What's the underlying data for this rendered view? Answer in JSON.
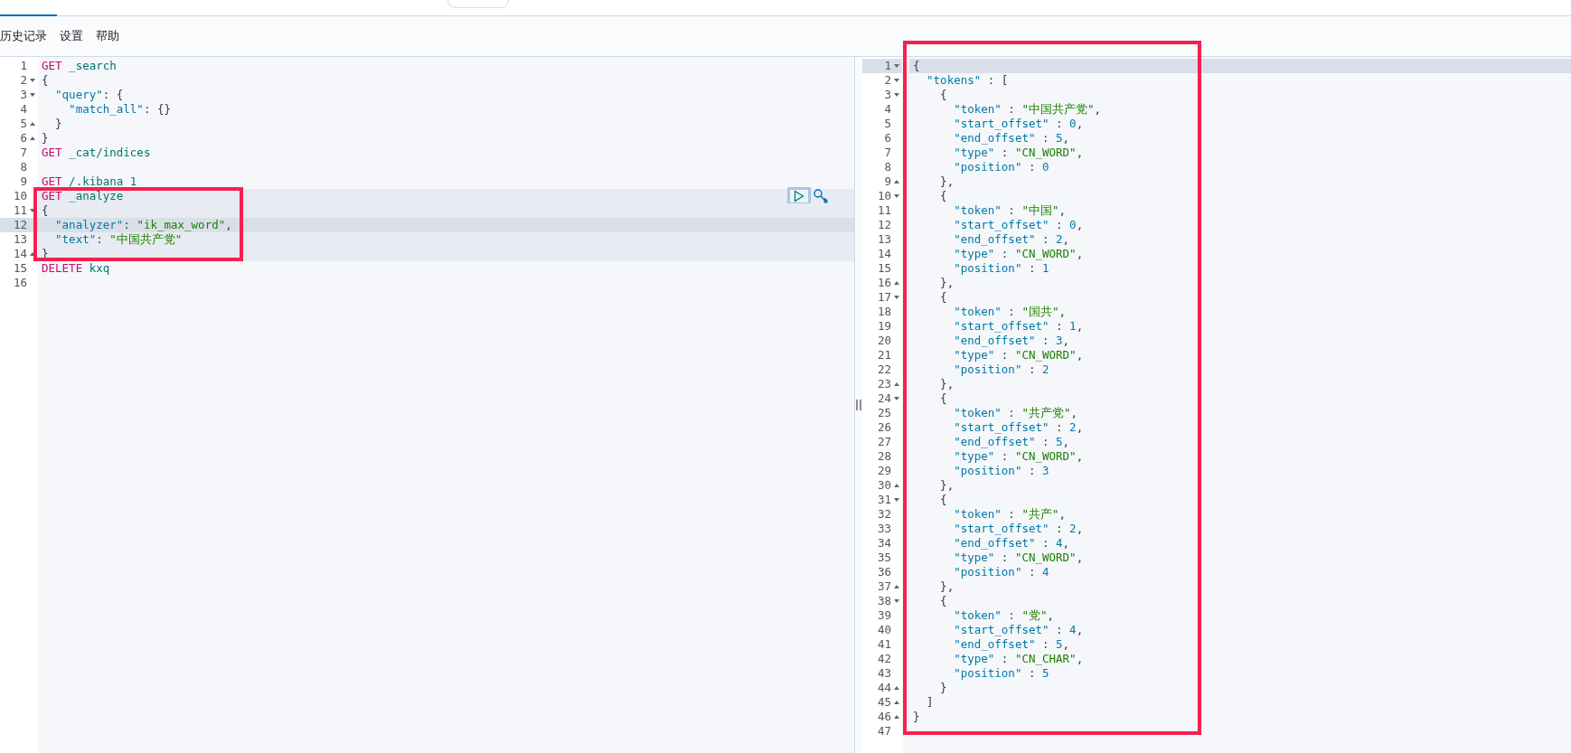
{
  "menu": [
    {
      "label": "历史记录"
    },
    {
      "label": "设置"
    },
    {
      "label": "帮助"
    }
  ],
  "request_editor": {
    "lines": [
      {
        "number": "1",
        "fold_start": false,
        "fold_end": false,
        "highlighted": false,
        "current": false,
        "tokens": [
          {
            "kind": "method",
            "text": "GET"
          },
          {
            "kind": "url",
            "text": " _search"
          }
        ]
      },
      {
        "number": "2",
        "fold_start": true,
        "fold_end": false,
        "highlighted": false,
        "current": false,
        "tokens": [
          {
            "kind": "punct",
            "text": "{"
          }
        ]
      },
      {
        "number": "3",
        "fold_start": true,
        "fold_end": false,
        "highlighted": false,
        "current": false,
        "tokens": [
          {
            "kind": "key",
            "text": "  \"query\""
          },
          {
            "kind": "punct",
            "text": ": {"
          }
        ]
      },
      {
        "number": "4",
        "fold_start": false,
        "fold_end": false,
        "highlighted": false,
        "current": false,
        "tokens": [
          {
            "kind": "key",
            "text": "    \"match_all\""
          },
          {
            "kind": "punct",
            "text": ": {}"
          }
        ]
      },
      {
        "number": "5",
        "fold_start": false,
        "fold_end": true,
        "highlighted": false,
        "current": false,
        "tokens": [
          {
            "kind": "punct",
            "text": "  }"
          }
        ]
      },
      {
        "number": "6",
        "fold_start": false,
        "fold_end": true,
        "highlighted": false,
        "current": false,
        "tokens": [
          {
            "kind": "punct",
            "text": "}"
          }
        ]
      },
      {
        "number": "7",
        "fold_start": false,
        "fold_end": false,
        "highlighted": false,
        "current": false,
        "tokens": [
          {
            "kind": "method",
            "text": "GET"
          },
          {
            "kind": "url",
            "text": " _cat/indices"
          }
        ]
      },
      {
        "number": "8",
        "fold_start": false,
        "fold_end": false,
        "highlighted": false,
        "current": false
      },
      {
        "number": "9",
        "fold_start": false,
        "fold_end": false,
        "highlighted": false,
        "current": false,
        "tokens": [
          {
            "kind": "method",
            "text": "GET"
          },
          {
            "kind": "url",
            "text": " /.kibana_1"
          }
        ]
      },
      {
        "number": "10",
        "fold_start": false,
        "fold_end": false,
        "highlighted": true,
        "current": false,
        "actions": true,
        "tokens": [
          {
            "kind": "method",
            "text": "GET"
          },
          {
            "kind": "url",
            "text": " _analyze"
          }
        ]
      },
      {
        "number": "11",
        "fold_start": true,
        "fold_end": false,
        "highlighted": true,
        "current": false,
        "tokens": [
          {
            "kind": "punct",
            "text": "{"
          }
        ]
      },
      {
        "number": "12",
        "fold_start": false,
        "fold_end": false,
        "highlighted": true,
        "current": true,
        "tokens": [
          {
            "kind": "key",
            "text": "  \"analyzer\""
          },
          {
            "kind": "punct",
            "text": ": "
          },
          {
            "kind": "string",
            "text": "\"ik_max_word\""
          },
          {
            "kind": "punct",
            "text": ","
          }
        ]
      },
      {
        "number": "13",
        "fold_start": false,
        "fold_end": false,
        "highlighted": true,
        "current": false,
        "tokens": [
          {
            "kind": "key",
            "text": "  \"text\""
          },
          {
            "kind": "punct",
            "text": ": "
          },
          {
            "kind": "string",
            "text": "\"中国共产党\""
          }
        ]
      },
      {
        "number": "14",
        "fold_start": false,
        "fold_end": true,
        "highlighted": true,
        "current": false,
        "tokens": [
          {
            "kind": "punct",
            "text": "}"
          }
        ]
      },
      {
        "number": "15",
        "fold_start": false,
        "fold_end": false,
        "highlighted": false,
        "current": false,
        "tokens": [
          {
            "kind": "method",
            "text": "DELETE"
          },
          {
            "kind": "url",
            "text": " kxq"
          }
        ]
      },
      {
        "number": "16",
        "fold_start": false,
        "fold_end": false,
        "highlighted": false,
        "current": false
      }
    ]
  },
  "response_viewer": {
    "lines": [
      {
        "number": "1",
        "fold_start": true,
        "fold_end": false,
        "current": true,
        "tokens": [
          {
            "kind": "punct",
            "text": "{"
          }
        ]
      },
      {
        "number": "2",
        "fold_start": true,
        "fold_end": false,
        "current": false,
        "tokens": [
          {
            "kind": "key",
            "text": "  \"tokens\""
          },
          {
            "kind": "punct",
            "text": " : ["
          }
        ]
      },
      {
        "number": "3",
        "fold_start": true,
        "fold_end": false,
        "current": false,
        "tokens": [
          {
            "kind": "punct",
            "text": "    {"
          }
        ]
      },
      {
        "number": "4",
        "fold_start": false,
        "fold_end": false,
        "current": false,
        "tokens": [
          {
            "kind": "key",
            "text": "      \"token\""
          },
          {
            "kind": "punct",
            "text": " : "
          },
          {
            "kind": "string",
            "text": "\"中国共产党\""
          },
          {
            "kind": "punct",
            "text": ","
          }
        ]
      },
      {
        "number": "5",
        "fold_start": false,
        "fold_end": false,
        "current": false,
        "tokens": [
          {
            "kind": "key",
            "text": "      \"start_offset\""
          },
          {
            "kind": "punct",
            "text": " : "
          },
          {
            "kind": "number",
            "text": "0"
          },
          {
            "kind": "punct",
            "text": ","
          }
        ]
      },
      {
        "number": "6",
        "fold_start": false,
        "fold_end": false,
        "current": false,
        "tokens": [
          {
            "kind": "key",
            "text": "      \"end_offset\""
          },
          {
            "kind": "punct",
            "text": " : "
          },
          {
            "kind": "number",
            "text": "5"
          },
          {
            "kind": "punct",
            "text": ","
          }
        ]
      },
      {
        "number": "7",
        "fold_start": false,
        "fold_end": false,
        "current": false,
        "tokens": [
          {
            "kind": "key",
            "text": "      \"type\""
          },
          {
            "kind": "punct",
            "text": " : "
          },
          {
            "kind": "string",
            "text": "\"CN_WORD\""
          },
          {
            "kind": "punct",
            "text": ","
          }
        ]
      },
      {
        "number": "8",
        "fold_start": false,
        "fold_end": false,
        "current": false,
        "tokens": [
          {
            "kind": "key",
            "text": "      \"position\""
          },
          {
            "kind": "punct",
            "text": " : "
          },
          {
            "kind": "number",
            "text": "0"
          }
        ]
      },
      {
        "number": "9",
        "fold_start": false,
        "fold_end": true,
        "current": false,
        "tokens": [
          {
            "kind": "punct",
            "text": "    },"
          }
        ]
      },
      {
        "number": "10",
        "fold_start": true,
        "fold_end": false,
        "current": false,
        "tokens": [
          {
            "kind": "punct",
            "text": "    {"
          }
        ]
      },
      {
        "number": "11",
        "fold_start": false,
        "fold_end": false,
        "current": false,
        "tokens": [
          {
            "kind": "key",
            "text": "      \"token\""
          },
          {
            "kind": "punct",
            "text": " : "
          },
          {
            "kind": "string",
            "text": "\"中国\""
          },
          {
            "kind": "punct",
            "text": ","
          }
        ]
      },
      {
        "number": "12",
        "fold_start": false,
        "fold_end": false,
        "current": false,
        "tokens": [
          {
            "kind": "key",
            "text": "      \"start_offset\""
          },
          {
            "kind": "punct",
            "text": " : "
          },
          {
            "kind": "number",
            "text": "0"
          },
          {
            "kind": "punct",
            "text": ","
          }
        ]
      },
      {
        "number": "13",
        "fold_start": false,
        "fold_end": false,
        "current": false,
        "tokens": [
          {
            "kind": "key",
            "text": "      \"end_offset\""
          },
          {
            "kind": "punct",
            "text": " : "
          },
          {
            "kind": "number",
            "text": "2"
          },
          {
            "kind": "punct",
            "text": ","
          }
        ]
      },
      {
        "number": "14",
        "fold_start": false,
        "fold_end": false,
        "current": false,
        "tokens": [
          {
            "kind": "key",
            "text": "      \"type\""
          },
          {
            "kind": "punct",
            "text": " : "
          },
          {
            "kind": "string",
            "text": "\"CN_WORD\""
          },
          {
            "kind": "punct",
            "text": ","
          }
        ]
      },
      {
        "number": "15",
        "fold_start": false,
        "fold_end": false,
        "current": false,
        "tokens": [
          {
            "kind": "key",
            "text": "      \"position\""
          },
          {
            "kind": "punct",
            "text": " : "
          },
          {
            "kind": "number",
            "text": "1"
          }
        ]
      },
      {
        "number": "16",
        "fold_start": false,
        "fold_end": true,
        "current": false,
        "tokens": [
          {
            "kind": "punct",
            "text": "    },"
          }
        ]
      },
      {
        "number": "17",
        "fold_start": true,
        "fold_end": false,
        "current": false,
        "tokens": [
          {
            "kind": "punct",
            "text": "    {"
          }
        ]
      },
      {
        "number": "18",
        "fold_start": false,
        "fold_end": false,
        "current": false,
        "tokens": [
          {
            "kind": "key",
            "text": "      \"token\""
          },
          {
            "kind": "punct",
            "text": " : "
          },
          {
            "kind": "string",
            "text": "\"国共\""
          },
          {
            "kind": "punct",
            "text": ","
          }
        ]
      },
      {
        "number": "19",
        "fold_start": false,
        "fold_end": false,
        "current": false,
        "tokens": [
          {
            "kind": "key",
            "text": "      \"start_offset\""
          },
          {
            "kind": "punct",
            "text": " : "
          },
          {
            "kind": "number",
            "text": "1"
          },
          {
            "kind": "punct",
            "text": ","
          }
        ]
      },
      {
        "number": "20",
        "fold_start": false,
        "fold_end": false,
        "current": false,
        "tokens": [
          {
            "kind": "key",
            "text": "      \"end_offset\""
          },
          {
            "kind": "punct",
            "text": " : "
          },
          {
            "kind": "number",
            "text": "3"
          },
          {
            "kind": "punct",
            "text": ","
          }
        ]
      },
      {
        "number": "21",
        "fold_start": false,
        "fold_end": false,
        "current": false,
        "tokens": [
          {
            "kind": "key",
            "text": "      \"type\""
          },
          {
            "kind": "punct",
            "text": " : "
          },
          {
            "kind": "string",
            "text": "\"CN_WORD\""
          },
          {
            "kind": "punct",
            "text": ","
          }
        ]
      },
      {
        "number": "22",
        "fold_start": false,
        "fold_end": false,
        "current": false,
        "tokens": [
          {
            "kind": "key",
            "text": "      \"position\""
          },
          {
            "kind": "punct",
            "text": " : "
          },
          {
            "kind": "number",
            "text": "2"
          }
        ]
      },
      {
        "number": "23",
        "fold_start": false,
        "fold_end": true,
        "current": false,
        "tokens": [
          {
            "kind": "punct",
            "text": "    },"
          }
        ]
      },
      {
        "number": "24",
        "fold_start": true,
        "fold_end": false,
        "current": false,
        "tokens": [
          {
            "kind": "punct",
            "text": "    {"
          }
        ]
      },
      {
        "number": "25",
        "fold_start": false,
        "fold_end": false,
        "current": false,
        "tokens": [
          {
            "kind": "key",
            "text": "      \"token\""
          },
          {
            "kind": "punct",
            "text": " : "
          },
          {
            "kind": "string",
            "text": "\"共产党\""
          },
          {
            "kind": "punct",
            "text": ","
          }
        ]
      },
      {
        "number": "26",
        "fold_start": false,
        "fold_end": false,
        "current": false,
        "tokens": [
          {
            "kind": "key",
            "text": "      \"start_offset\""
          },
          {
            "kind": "punct",
            "text": " : "
          },
          {
            "kind": "number",
            "text": "2"
          },
          {
            "kind": "punct",
            "text": ","
          }
        ]
      },
      {
        "number": "27",
        "fold_start": false,
        "fold_end": false,
        "current": false,
        "tokens": [
          {
            "kind": "key",
            "text": "      \"end_offset\""
          },
          {
            "kind": "punct",
            "text": " : "
          },
          {
            "kind": "number",
            "text": "5"
          },
          {
            "kind": "punct",
            "text": ","
          }
        ]
      },
      {
        "number": "28",
        "fold_start": false,
        "fold_end": false,
        "current": false,
        "tokens": [
          {
            "kind": "key",
            "text": "      \"type\""
          },
          {
            "kind": "punct",
            "text": " : "
          },
          {
            "kind": "string",
            "text": "\"CN_WORD\""
          },
          {
            "kind": "punct",
            "text": ","
          }
        ]
      },
      {
        "number": "29",
        "fold_start": false,
        "fold_end": false,
        "current": false,
        "tokens": [
          {
            "kind": "key",
            "text": "      \"position\""
          },
          {
            "kind": "punct",
            "text": " : "
          },
          {
            "kind": "number",
            "text": "3"
          }
        ]
      },
      {
        "number": "30",
        "fold_start": false,
        "fold_end": true,
        "current": false,
        "tokens": [
          {
            "kind": "punct",
            "text": "    },"
          }
        ]
      },
      {
        "number": "31",
        "fold_start": true,
        "fold_end": false,
        "current": false,
        "tokens": [
          {
            "kind": "punct",
            "text": "    {"
          }
        ]
      },
      {
        "number": "32",
        "fold_start": false,
        "fold_end": false,
        "current": false,
        "tokens": [
          {
            "kind": "key",
            "text": "      \"token\""
          },
          {
            "kind": "punct",
            "text": " : "
          },
          {
            "kind": "string",
            "text": "\"共产\""
          },
          {
            "kind": "punct",
            "text": ","
          }
        ]
      },
      {
        "number": "33",
        "fold_start": false,
        "fold_end": false,
        "current": false,
        "tokens": [
          {
            "kind": "key",
            "text": "      \"start_offset\""
          },
          {
            "kind": "punct",
            "text": " : "
          },
          {
            "kind": "number",
            "text": "2"
          },
          {
            "kind": "punct",
            "text": ","
          }
        ]
      },
      {
        "number": "34",
        "fold_start": false,
        "fold_end": false,
        "current": false,
        "tokens": [
          {
            "kind": "key",
            "text": "      \"end_offset\""
          },
          {
            "kind": "punct",
            "text": " : "
          },
          {
            "kind": "number",
            "text": "4"
          },
          {
            "kind": "punct",
            "text": ","
          }
        ]
      },
      {
        "number": "35",
        "fold_start": false,
        "fold_end": false,
        "current": false,
        "tokens": [
          {
            "kind": "key",
            "text": "      \"type\""
          },
          {
            "kind": "punct",
            "text": " : "
          },
          {
            "kind": "string",
            "text": "\"CN_WORD\""
          },
          {
            "kind": "punct",
            "text": ","
          }
        ]
      },
      {
        "number": "36",
        "fold_start": false,
        "fold_end": false,
        "current": false,
        "tokens": [
          {
            "kind": "key",
            "text": "      \"position\""
          },
          {
            "kind": "punct",
            "text": " : "
          },
          {
            "kind": "number",
            "text": "4"
          }
        ]
      },
      {
        "number": "37",
        "fold_start": false,
        "fold_end": true,
        "current": false,
        "tokens": [
          {
            "kind": "punct",
            "text": "    },"
          }
        ]
      },
      {
        "number": "38",
        "fold_start": true,
        "fold_end": false,
        "current": false,
        "tokens": [
          {
            "kind": "punct",
            "text": "    {"
          }
        ]
      },
      {
        "number": "39",
        "fold_start": false,
        "fold_end": false,
        "current": false,
        "tokens": [
          {
            "kind": "key",
            "text": "      \"token\""
          },
          {
            "kind": "punct",
            "text": " : "
          },
          {
            "kind": "string",
            "text": "\"党\""
          },
          {
            "kind": "punct",
            "text": ","
          }
        ]
      },
      {
        "number": "40",
        "fold_start": false,
        "fold_end": false,
        "current": false,
        "tokens": [
          {
            "kind": "key",
            "text": "      \"start_offset\""
          },
          {
            "kind": "punct",
            "text": " : "
          },
          {
            "kind": "number",
            "text": "4"
          },
          {
            "kind": "punct",
            "text": ","
          }
        ]
      },
      {
        "number": "41",
        "fold_start": false,
        "fold_end": false,
        "current": false,
        "tokens": [
          {
            "kind": "key",
            "text": "      \"end_offset\""
          },
          {
            "kind": "punct",
            "text": " : "
          },
          {
            "kind": "number",
            "text": "5"
          },
          {
            "kind": "punct",
            "text": ","
          }
        ]
      },
      {
        "number": "42",
        "fold_start": false,
        "fold_end": false,
        "current": false,
        "tokens": [
          {
            "kind": "key",
            "text": "      \"type\""
          },
          {
            "kind": "punct",
            "text": " : "
          },
          {
            "kind": "string",
            "text": "\"CN_CHAR\""
          },
          {
            "kind": "punct",
            "text": ","
          }
        ]
      },
      {
        "number": "43",
        "fold_start": false,
        "fold_end": false,
        "current": false,
        "tokens": [
          {
            "kind": "key",
            "text": "      \"position\""
          },
          {
            "kind": "punct",
            "text": " : "
          },
          {
            "kind": "number",
            "text": "5"
          }
        ]
      },
      {
        "number": "44",
        "fold_start": false,
        "fold_end": true,
        "current": false,
        "tokens": [
          {
            "kind": "punct",
            "text": "    }"
          }
        ]
      },
      {
        "number": "45",
        "fold_start": false,
        "fold_end": true,
        "current": false,
        "tokens": [
          {
            "kind": "punct",
            "text": "  ]"
          }
        ]
      },
      {
        "number": "46",
        "fold_start": false,
        "fold_end": true,
        "current": false,
        "tokens": [
          {
            "kind": "punct",
            "text": "}"
          }
        ]
      },
      {
        "number": "47",
        "fold_start": false,
        "fold_end": false,
        "current": false
      }
    ]
  }
}
